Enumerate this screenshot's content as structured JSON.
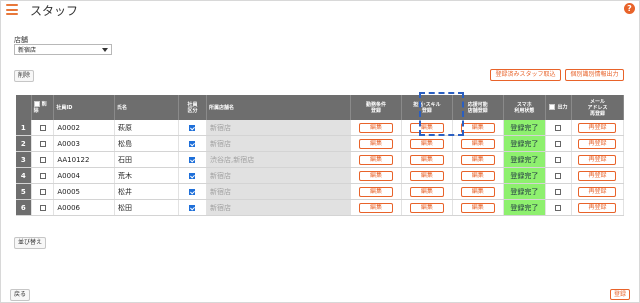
{
  "header": {
    "title": "スタッフ"
  },
  "store": {
    "label": "店舗",
    "selected": "新宿店"
  },
  "toolbar": {
    "delete_label": "削除",
    "import_label": "登録済みスタッフ取込",
    "export_label": "個別識別情報出力"
  },
  "table": {
    "headers": {
      "delete": "削除",
      "id": "社員ID",
      "name": "氏名",
      "employee_type": "社員\n区分",
      "store": "所属店舗名",
      "work_conditions": "勤務条件\n登録",
      "skills": "担当･スキル\n登録",
      "support_store": "応援可能\n店舗登録",
      "smartphone": "スマホ\n利用状態",
      "output": "出力",
      "mail": "メール\nアドレス\n再登録"
    },
    "rows": [
      {
        "num": "1",
        "id": "A0002",
        "name": "萩原",
        "store": "新宿店",
        "edit": "編集",
        "status": "登録完了",
        "reregister": "再登録"
      },
      {
        "num": "2",
        "id": "A0003",
        "name": "松島",
        "store": "新宿店",
        "edit": "編集",
        "status": "登録完了",
        "reregister": "再登録"
      },
      {
        "num": "3",
        "id": "AA10122",
        "name": "石田",
        "store": "渋谷店,新宿店",
        "edit": "編集",
        "status": "登録完了",
        "reregister": "再登録"
      },
      {
        "num": "4",
        "id": "A0004",
        "name": "荒木",
        "store": "新宿店",
        "edit": "編集",
        "status": "登録完了",
        "reregister": "再登録"
      },
      {
        "num": "5",
        "id": "A0005",
        "name": "松井",
        "store": "新宿店",
        "edit": "編集",
        "status": "登録完了",
        "reregister": "再登録"
      },
      {
        "num": "6",
        "id": "A0006",
        "name": "松田",
        "store": "新宿店",
        "edit": "編集",
        "status": "登録完了",
        "reregister": "再登録"
      }
    ]
  },
  "sort_label": "並び替え",
  "footer": {
    "back_label": "戻る",
    "save_label": "登録"
  },
  "colors": {
    "accent": "#e8632a",
    "status_green": "#8ef06e",
    "header_gray": "#6e6e6e"
  }
}
